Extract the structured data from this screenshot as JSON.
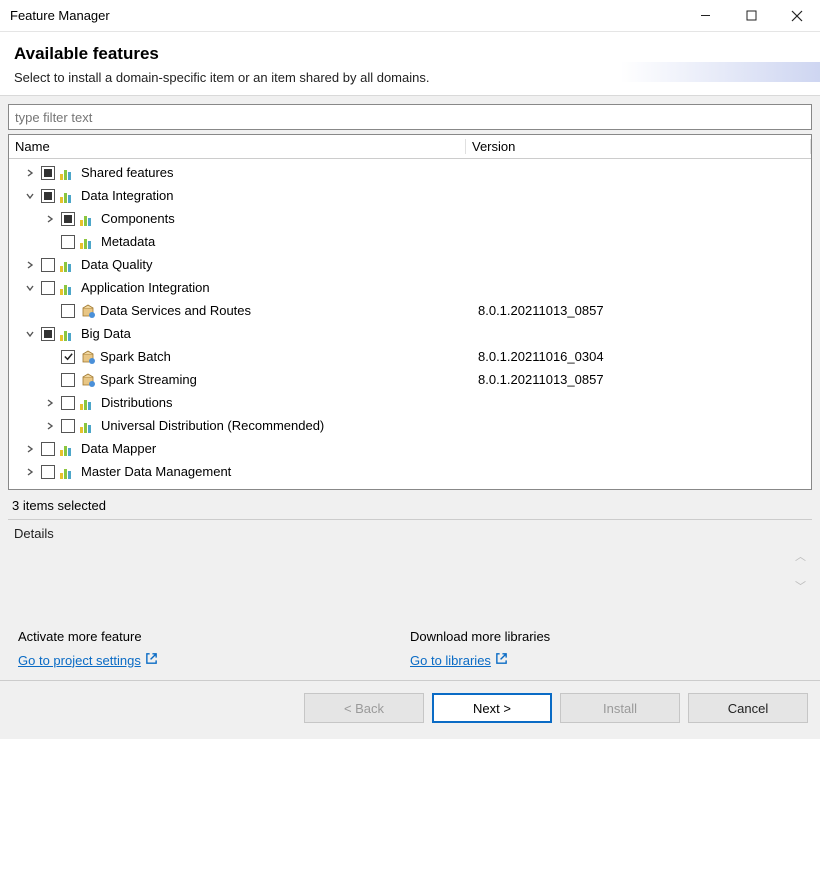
{
  "window": {
    "title": "Feature Manager"
  },
  "header": {
    "title": "Available features",
    "subtitle": "Select to install a domain-specific item or an item shared by all domains."
  },
  "filter": {
    "placeholder": "type filter text"
  },
  "columns": {
    "name": "Name",
    "version": "Version"
  },
  "tree": [
    {
      "indent": 0,
      "toggle": "closed",
      "check": "partial",
      "icon": "bars",
      "label": "Shared features",
      "version": ""
    },
    {
      "indent": 0,
      "toggle": "open",
      "check": "partial",
      "icon": "bars",
      "label": "Data Integration",
      "version": ""
    },
    {
      "indent": 1,
      "toggle": "closed",
      "check": "partial",
      "icon": "bars",
      "label": "Components",
      "version": ""
    },
    {
      "indent": 1,
      "toggle": "none",
      "check": "empty",
      "icon": "bars",
      "label": "Metadata",
      "version": ""
    },
    {
      "indent": 0,
      "toggle": "closed",
      "check": "empty",
      "icon": "bars",
      "label": "Data Quality",
      "version": ""
    },
    {
      "indent": 0,
      "toggle": "open",
      "check": "empty",
      "icon": "bars",
      "label": "Application Integration",
      "version": ""
    },
    {
      "indent": 1,
      "toggle": "none",
      "check": "empty",
      "icon": "pkg",
      "label": "Data Services and Routes",
      "version": "8.0.1.20211013_0857"
    },
    {
      "indent": 0,
      "toggle": "open",
      "check": "partial",
      "icon": "bars",
      "label": "Big Data",
      "version": ""
    },
    {
      "indent": 1,
      "toggle": "none",
      "check": "checked",
      "icon": "pkg",
      "label": "Spark Batch",
      "version": "8.0.1.20211016_0304"
    },
    {
      "indent": 1,
      "toggle": "none",
      "check": "empty",
      "icon": "pkg",
      "label": "Spark Streaming",
      "version": "8.0.1.20211013_0857"
    },
    {
      "indent": 1,
      "toggle": "closed",
      "check": "empty",
      "icon": "bars",
      "label": "Distributions",
      "version": ""
    },
    {
      "indent": 1,
      "toggle": "closed",
      "check": "empty",
      "icon": "bars",
      "label": "Universal Distribution (Recommended)",
      "version": ""
    },
    {
      "indent": 0,
      "toggle": "closed",
      "check": "empty",
      "icon": "bars",
      "label": "Data Mapper",
      "version": ""
    },
    {
      "indent": 0,
      "toggle": "closed",
      "check": "empty",
      "icon": "bars",
      "label": "Master Data Management",
      "version": ""
    }
  ],
  "status": "3 items selected",
  "details": {
    "label": "Details"
  },
  "links": {
    "left": {
      "label": "Activate more feature",
      "link": "Go to project settings"
    },
    "right": {
      "label": "Download more libraries",
      "link": "Go to libraries"
    }
  },
  "footer": {
    "back": "< Back",
    "next": "Next >",
    "install": "Install",
    "cancel": "Cancel"
  }
}
